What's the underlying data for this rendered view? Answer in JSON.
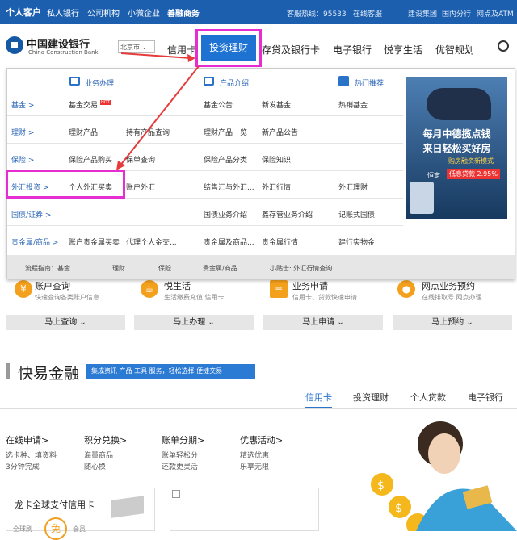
{
  "topbar": {
    "personal": "个人客户",
    "private": "私人银行",
    "corporate": "公司机构",
    "small": "小微企业",
    "commerce": "善融商务",
    "hotline": "客服热线：95533",
    "online": "在线客服",
    "group": "建设集团",
    "domestic": "国内分行",
    "outlets": "网点及ATM"
  },
  "logo": {
    "cn": "中国建设银行",
    "en": "China Construction Bank"
  },
  "city": "北京市",
  "nav": [
    "信用卡",
    "投资理财",
    "存贷及银行卡",
    "电子银行",
    "悦享生活",
    "优智规划"
  ],
  "menu": {
    "col_heads": [
      "业务办理",
      "产品介绍",
      "热门推荐"
    ],
    "hot_badge": "HOT",
    "rows": [
      {
        "cat": "基金 >",
        "items": [
          "基金交易",
          "基金公告",
          "新发基金",
          "热销基金"
        ]
      },
      {
        "cat": "理财 >",
        "items": [
          "理财产品",
          "持有产品查询",
          "理财产品一览",
          "新产品公告"
        ]
      },
      {
        "cat": "保险 >",
        "items": [
          "保险产品购买",
          "保单查询",
          "保险产品分类",
          "保险知识"
        ]
      },
      {
        "cat": "外汇投资 >",
        "items": [
          "个人外汇买卖",
          "账户外汇",
          "结售汇与外汇...",
          "外汇行情",
          "外汇理财"
        ]
      },
      {
        "cat": "国债/证券 >",
        "items": [
          "国债业务介绍",
          "鑫存管业务介绍",
          "记账式国债"
        ]
      },
      {
        "cat": "贵金属/商品 >",
        "items": [
          "账户贵金属买卖",
          "代理个人金交...",
          "贵金属及商品...",
          "贵金属行情",
          "建行实物金"
        ]
      }
    ],
    "guide": [
      "流程指南：基金",
      "理财",
      "保险",
      "贵金属/商品",
      "小贴士: 外汇行情查询"
    ],
    "ad": {
      "line1": "每月中德揽点钱",
      "line2": "来日轻松买好房",
      "line3": "购房融资新模式",
      "line4": "恒定",
      "line5": "低息贷款 2.95%"
    }
  },
  "services": [
    {
      "title": "账户查询",
      "sub": "快速查询各类账户信息",
      "btn": "马上查询"
    },
    {
      "title": "悦生活",
      "sub": "生活缴费充值 信用卡",
      "btn": "马上办理"
    },
    {
      "title": "业务申请",
      "sub": "信用卡、贷款快速申请",
      "btn": "马上申请"
    },
    {
      "title": "网点业务预约",
      "sub": "在线排取号 网点办理",
      "btn": "马上预约"
    }
  ],
  "section": {
    "title": "快易金融",
    "badge": "集成资讯 产品 工具 服务，轻松选择 便捷交易",
    "tabs": [
      "信用卡",
      "投资理财",
      "个人贷款",
      "电子银行"
    ]
  },
  "features": [
    {
      "title": "在线申请>",
      "l1": "选卡种、填资料",
      "l2": "3分钟完成"
    },
    {
      "title": "积分兑换>",
      "l1": "海量商品",
      "l2": "随心换"
    },
    {
      "title": "账单分期>",
      "l1": "账单轻松分",
      "l2": "还款更灵活"
    },
    {
      "title": "优惠活动>",
      "l1": "精选优惠",
      "l2": "乐享无限"
    }
  ],
  "card1": {
    "title": "龙卡全球支付信用卡",
    "big": "免",
    "sub1": "全球刷",
    "sub2": "会员"
  }
}
